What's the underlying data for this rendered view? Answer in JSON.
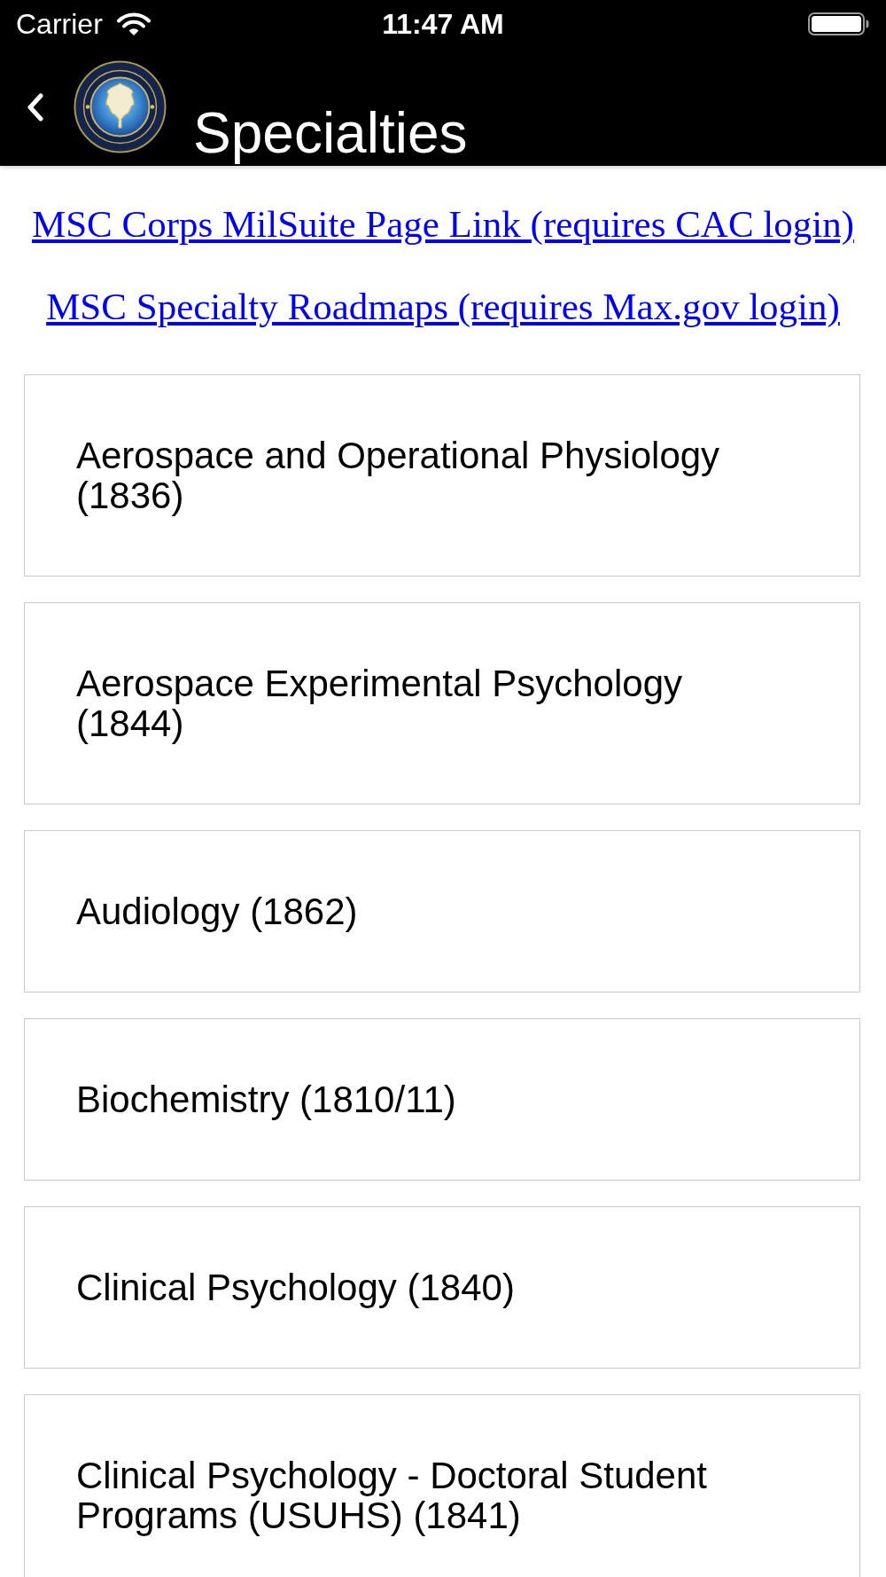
{
  "status_bar": {
    "carrier": "Carrier",
    "time": "11:47 AM"
  },
  "nav_bar": {
    "title": "Specialties"
  },
  "links": [
    {
      "text": "MSC Corps MilSuite Page Link (requires CAC login)"
    },
    {
      "text": "MSC Specialty Roadmaps (requires Max.gov login)"
    }
  ],
  "specialties": [
    {
      "label": "Aerospace and Operational Physiology (1836)"
    },
    {
      "label": "Aerospace Experimental Psychology (1844)"
    },
    {
      "label": "Audiology (1862)"
    },
    {
      "label": "Biochemistry (1810/11)"
    },
    {
      "label": "Clinical Psychology (1840)"
    },
    {
      "label": "Clinical Psychology - Doctoral Student Programs (USUHS) (1841)"
    }
  ]
}
